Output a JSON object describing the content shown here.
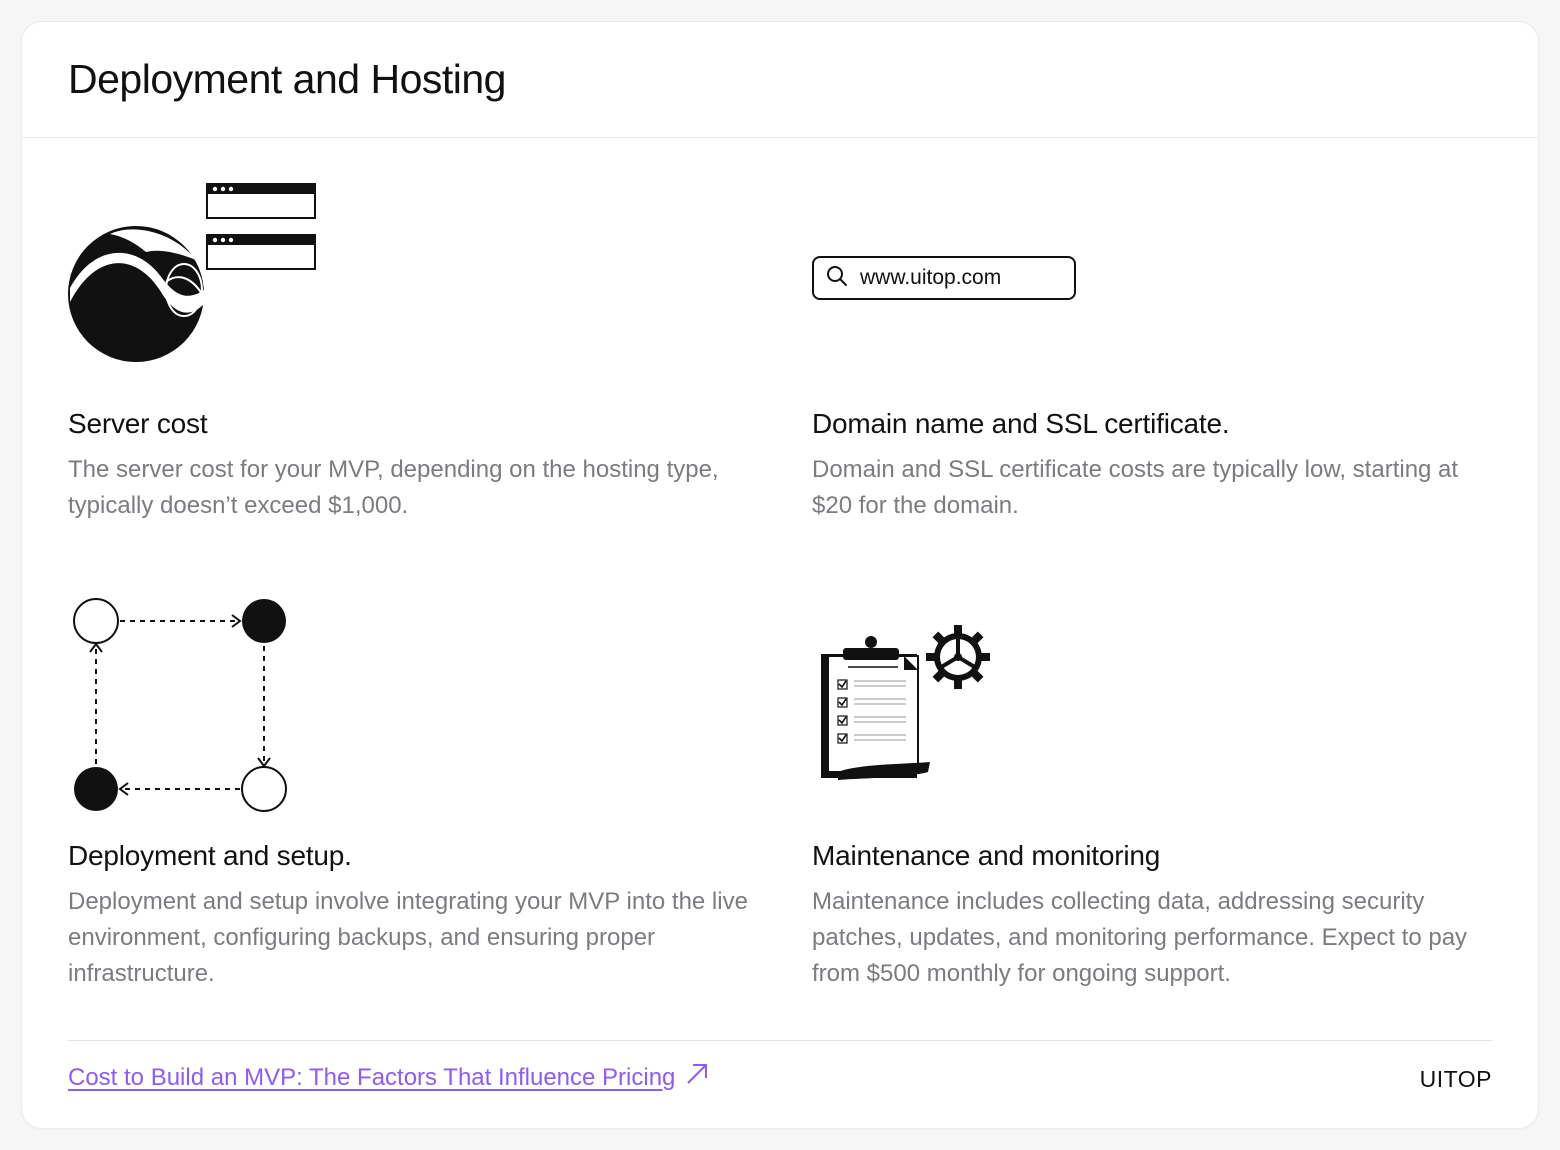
{
  "header": {
    "title": "Deployment and Hosting"
  },
  "items": [
    {
      "heading": "Server cost",
      "description": "The server cost for your MVP, depending on the hosting type, typically doesn’t exceed $1,000.",
      "icon": "server-globe-icon"
    },
    {
      "heading": "Domain name and SSL certificate.",
      "description": "Domain and SSL certificate costs are typically low, starting at $20 for the domain.",
      "icon": "search-icon",
      "search_value": "www.uitop.com"
    },
    {
      "heading": "Deployment and setup.",
      "description": "Deployment and setup involve integrating your MVP into the live environment, configuring backups, and ensuring proper infrastructure.",
      "icon": "deployment-cycle-icon"
    },
    {
      "heading": "Maintenance and monitoring",
      "description": "Maintenance includes collecting data, addressing security patches, updates, and monitoring performance. Expect to pay from $500 monthly for ongoing support.",
      "icon": "clipboard-gear-icon"
    }
  ],
  "footer": {
    "link_text": "Cost to Build an MVP: The Factors That Influence Pricing",
    "link_icon": "arrow-up-right-icon",
    "brand": "UITOP"
  },
  "colors": {
    "link": "#8b5cf6",
    "muted_text": "#7b7b80",
    "ink": "#111111"
  }
}
